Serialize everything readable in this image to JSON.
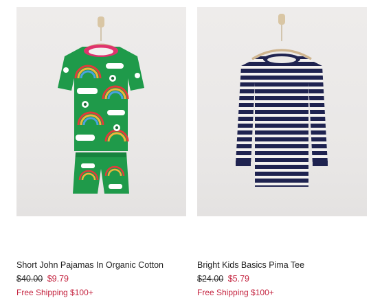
{
  "products": [
    {
      "name": "Short John Pajamas In Organic Cotton",
      "original_price": "$40.00",
      "sale_price": "$9.79",
      "shipping": "Free Shipping $100+"
    },
    {
      "name": "Bright Kids Basics Pima Tee",
      "original_price": "$24.00",
      "sale_price": "$5.79",
      "shipping": "Free Shipping $100+"
    }
  ],
  "colors": {
    "sale": "#c4233f",
    "pajama_green": "#1f9a4a",
    "collar_pink": "#e0336d",
    "stripe_navy": "#1f2350"
  }
}
